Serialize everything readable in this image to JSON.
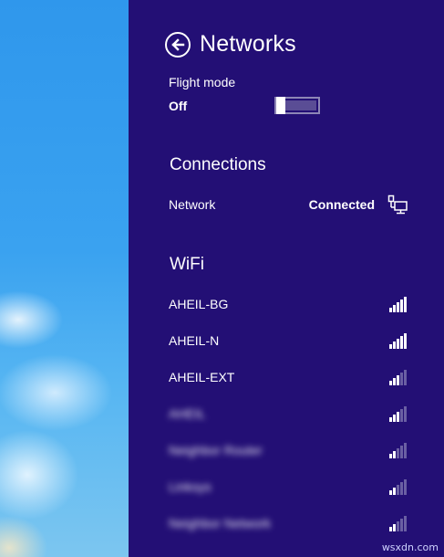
{
  "colors": {
    "panel_bg": "#230f75",
    "text": "#ffffff",
    "desktop_blue": "#3aa2f0"
  },
  "header": {
    "title": "Networks",
    "back_icon": "arrow-left-circle-icon"
  },
  "flight_mode": {
    "label": "Flight mode",
    "state": "Off",
    "on": false
  },
  "connections": {
    "heading": "Connections",
    "items": [
      {
        "name": "Network",
        "status": "Connected",
        "icon": "wired-network-icon"
      }
    ]
  },
  "wifi": {
    "heading": "WiFi",
    "networks": [
      {
        "name": "AHEIL-BG",
        "signal": 5,
        "blurred": false
      },
      {
        "name": "AHEIL-N",
        "signal": 5,
        "blurred": false
      },
      {
        "name": "AHEIL-EXT",
        "signal": 3,
        "blurred": false
      },
      {
        "name": "AHEIL",
        "signal": 3,
        "blurred": true
      },
      {
        "name": "Neighbor Router",
        "signal": 2,
        "blurred": true
      },
      {
        "name": "Linksys",
        "signal": 2,
        "blurred": true
      },
      {
        "name": "Neighbor Network",
        "signal": 2,
        "blurred": true
      }
    ]
  },
  "watermark": "wsxdn.com"
}
